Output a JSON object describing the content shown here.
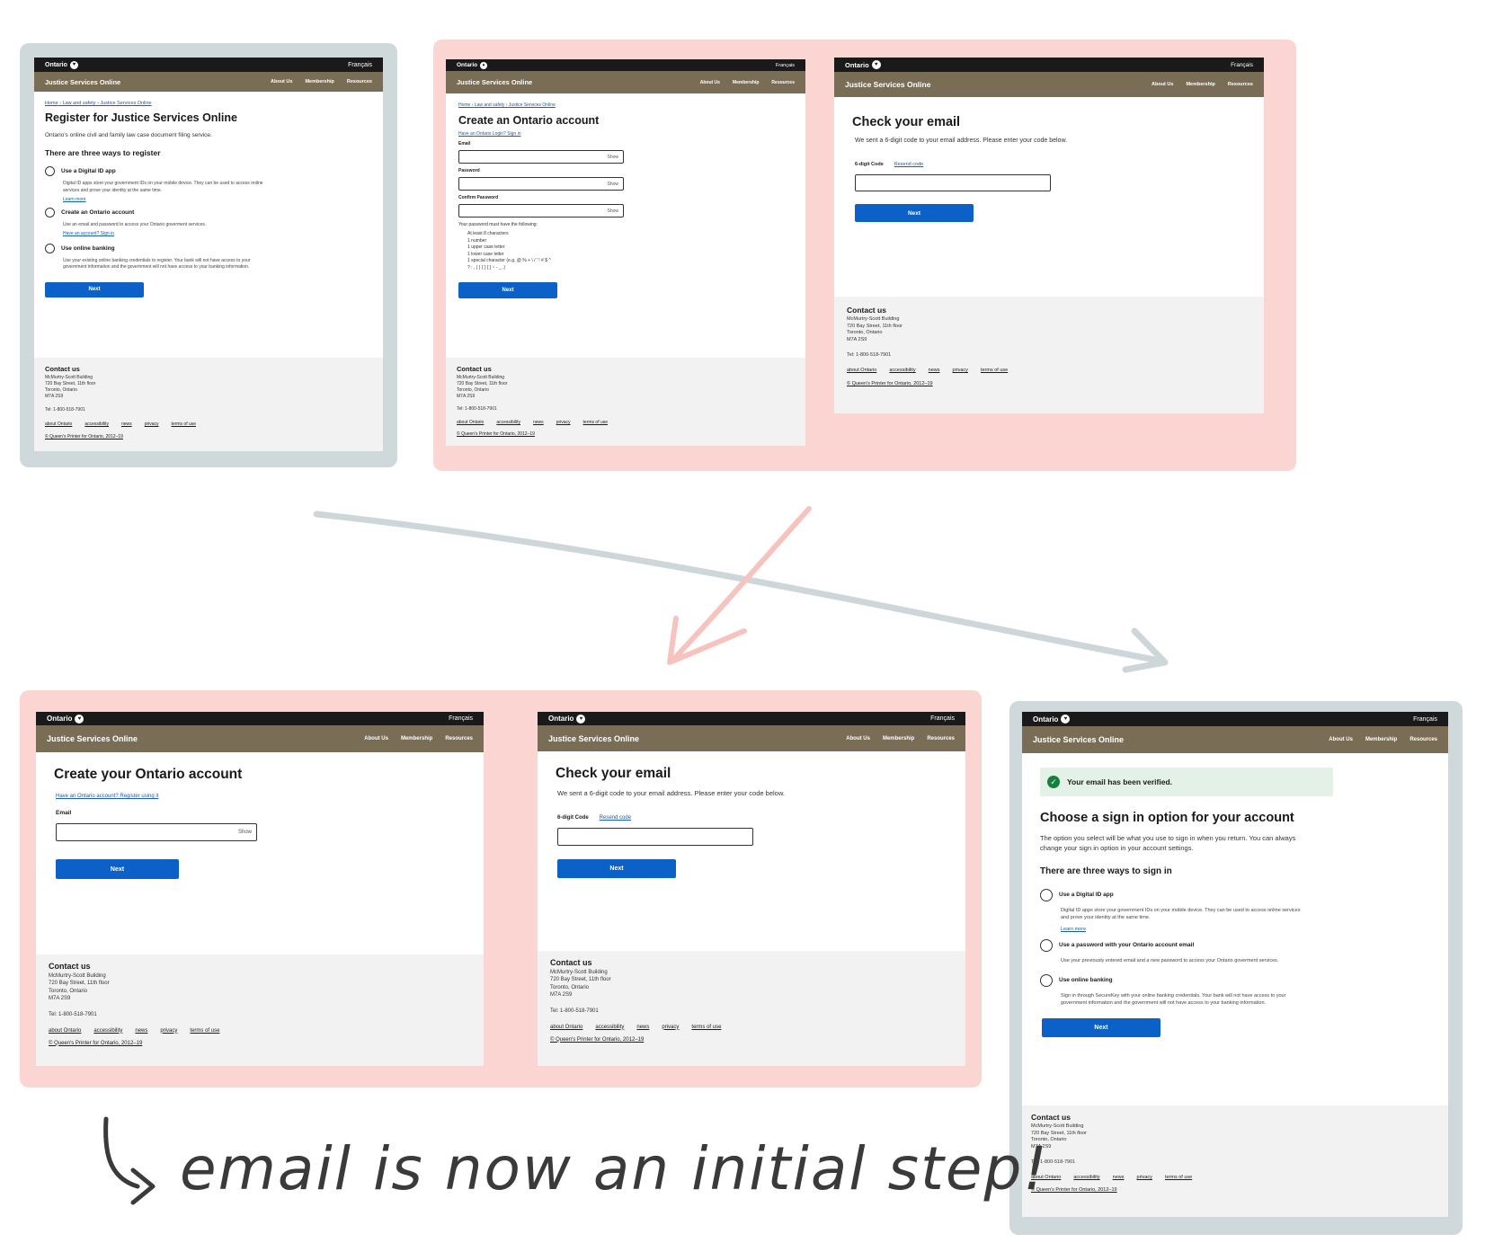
{
  "header": {
    "brand": "Ontario",
    "language_toggle": "Français",
    "site_name": "Justice Services Online",
    "nav": [
      "About Us",
      "Membership",
      "Resources"
    ]
  },
  "breadcrumb": [
    "Home",
    "Law and safety",
    "Justice Services Online"
  ],
  "footer": {
    "contact_title": "Contact us",
    "address": [
      "McMurtry-Scott Building",
      "720 Bay Street, 11th floor",
      "Toronto, Ontario",
      "M7A 2S9"
    ],
    "tel": "Tel: 1-800-518-7901",
    "links": [
      "about Ontario",
      "accessibility",
      "news",
      "privacy",
      "terms of use"
    ],
    "copyright": "© Queen's Printer for Ontario, 2012–19"
  },
  "register_page": {
    "title": "Register for Justice Services Online",
    "intro": "Ontario's online civil and family law case document filing service.",
    "ways_heading": "There are three ways to register",
    "options": [
      {
        "label": "Use a Digital ID app",
        "desc": "Digital ID apps store your government IDs on your mobile device. They can be used to access online services and prove your identity at the same time.",
        "link": "Learn more"
      },
      {
        "label": "Create an Ontario account",
        "desc": "Use an email and password to access your Ontario goverment services.",
        "link": "Have an account? Sign in"
      },
      {
        "label": "Use online banking",
        "desc": "Use your existing online banking credentials to register. Your bank will not have access to your government information and the government will not have access to your banking information.",
        "link": ""
      }
    ],
    "next": "Next"
  },
  "create_account_page": {
    "title": "Create an Ontario account",
    "signin_link": "Have an Ontario Login? Sign in",
    "email_label": "Email",
    "password_label": "Password",
    "confirm_label": "Confirm Password",
    "show": "Show",
    "rules_heading": "Your password must have the following:",
    "rules": [
      "At least 8 characters",
      "1 number",
      "1 upper case letter",
      "1 lower case letter",
      "1 special character (e.g. @ % + \\ / ' ! # $ ^",
      "? : , ( ) { } [ ] ~ - _ .)"
    ],
    "next": "Next"
  },
  "check_email_page": {
    "title": "Check your email",
    "text": "We sent a 6-digit code to your email address. Please enter your code below.",
    "code_label": "6-digit Code",
    "resend": "Resend code",
    "next": "Next"
  },
  "create_your_account_page": {
    "title": "Create your Ontario account",
    "register_link": "Have an Ontario account? Register using it",
    "email_label": "Email",
    "show": "Show",
    "next": "Next"
  },
  "choose_signin_page": {
    "banner": "Your email has been verified.",
    "title": "Choose a sign in option for your account",
    "intro": "The option you select will be what you use to sign in when you return. You can always change your sign in option in your account settings.",
    "ways_heading": "There are three ways to sign in",
    "options": [
      {
        "label": "Use a Digital ID app",
        "desc": "Digital ID apps store your government IDs on your mobile device. They can be used to access online services and prove your identity at the same time.",
        "link": "Learn more"
      },
      {
        "label": "Use a password with your Ontario account email",
        "desc": "Use your previously entered email and a new password to access your Ontario goverment services.",
        "link": ""
      },
      {
        "label": "Use online banking",
        "desc": "Sign in through SecureKey with your online banking credentials. Your bank will not have access to your government information and the government will not have access to your banking information.",
        "link": ""
      }
    ],
    "next": "Next"
  },
  "annotation": "email is now an initial step!",
  "colors": {
    "grey_frame": "#cfd9dc",
    "pink_frame": "#fad5d2",
    "nav_brown": "#7a6d56",
    "button_blue": "#0b61c8",
    "link_blue": "#1a5bb5"
  }
}
